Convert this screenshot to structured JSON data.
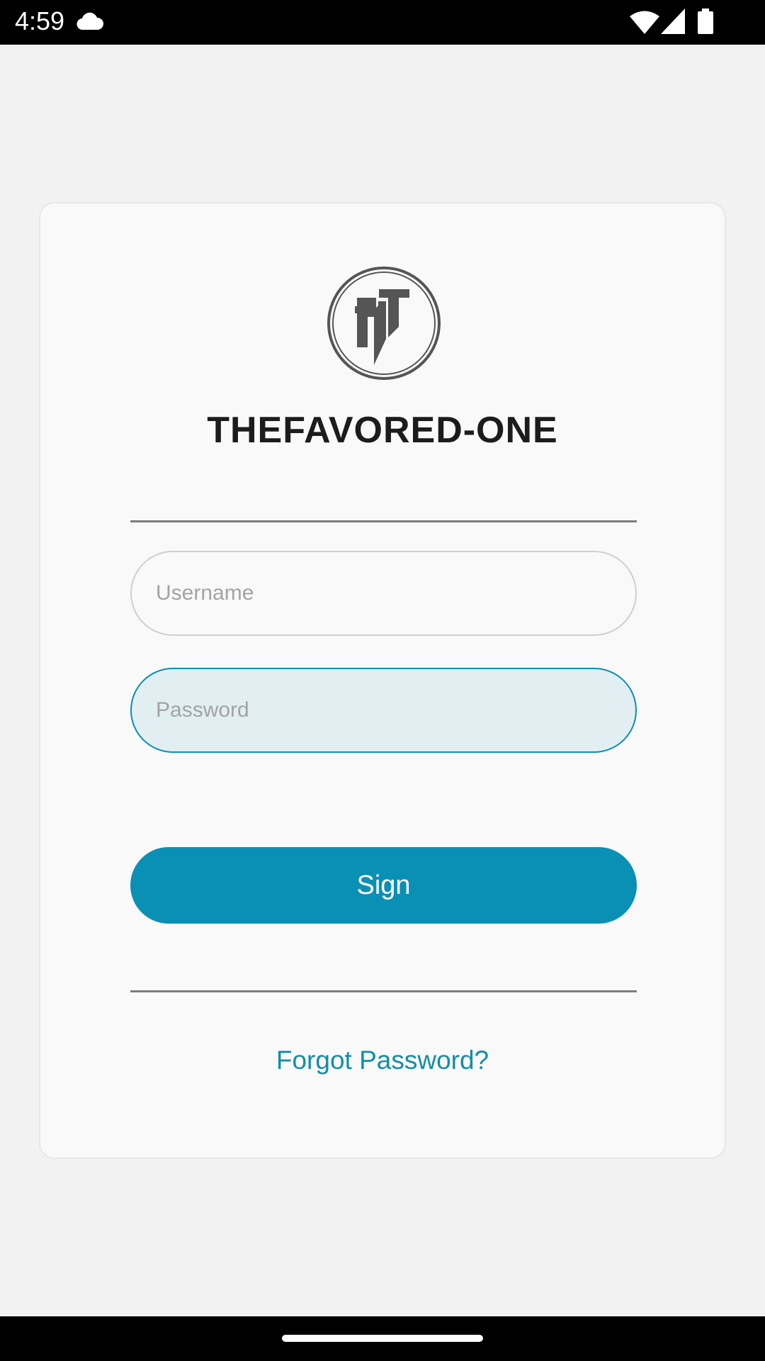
{
  "status_bar": {
    "time": "4:59",
    "icons": [
      "cloud-icon",
      "wifi-icon",
      "signal-icon",
      "battery-icon"
    ]
  },
  "login": {
    "logo_icon": "brand-logo-icon",
    "brand_title": "THEFAVORED-ONE",
    "username_placeholder": "Username",
    "username_value": "",
    "password_placeholder": "Password",
    "password_value": "",
    "sign_label": "Sign",
    "forgot_link": "Forgot Password?"
  },
  "colors": {
    "accent": "#0a90b4",
    "link": "#128ea8",
    "focused_field_bg": "#e1eff3",
    "card_bg": "#f9f9fa",
    "page_bg": "#f2f2f2"
  }
}
